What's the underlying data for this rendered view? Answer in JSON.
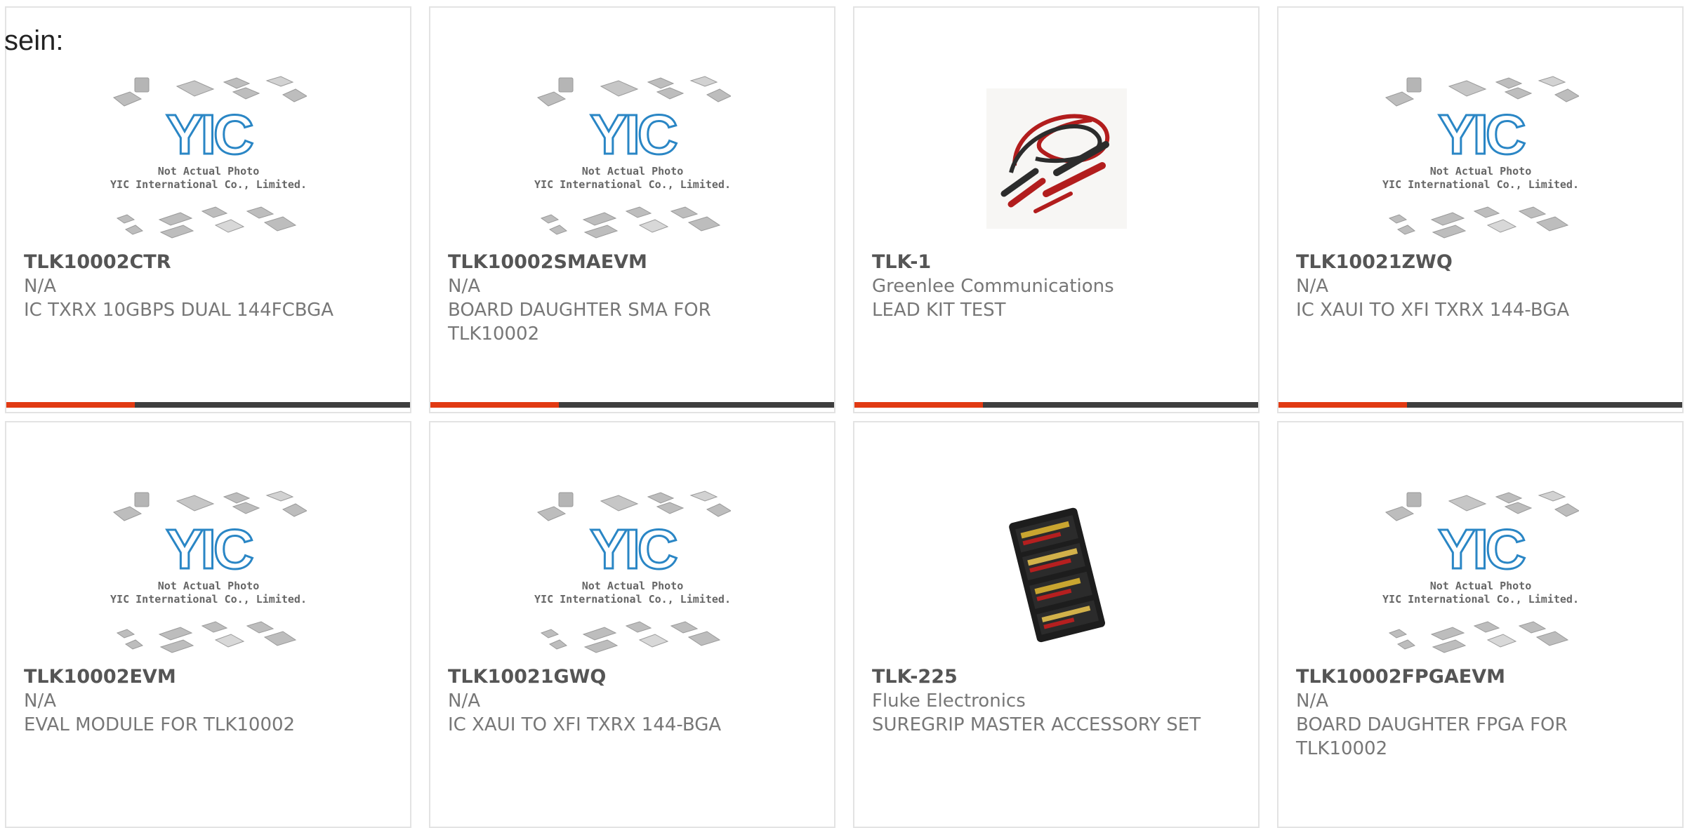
{
  "page": {
    "lead_text": "sein:"
  },
  "placeholder": {
    "logo_text": "YIC",
    "caption_line1": "Not Actual Photo",
    "caption_line2": "YIC International Co., Limited."
  },
  "colors": {
    "accent": "#e13a13",
    "bar": "#3f3f3f",
    "logo_blue": "#2a86c5",
    "text_primary": "#555555",
    "text_secondary": "#777777"
  },
  "products": [
    {
      "part_number": "TLK10002CTR",
      "manufacturer": "N/A",
      "description": "IC TXRX 10GBPS DUAL 144FCBGA",
      "image": "placeholder"
    },
    {
      "part_number": "TLK10002SMAEVM",
      "manufacturer": "N/A",
      "description": "BOARD DAUGHTER SMA FOR TLK10002",
      "image": "placeholder"
    },
    {
      "part_number": "TLK-1",
      "manufacturer": "Greenlee Communications",
      "description": "LEAD KIT TEST",
      "image": "test-leads-photo"
    },
    {
      "part_number": "TLK10021ZWQ",
      "manufacturer": "N/A",
      "description": "IC XAUI TO XFI TXRX 144-BGA",
      "image": "placeholder"
    },
    {
      "part_number": "TLK10002EVM",
      "manufacturer": "N/A",
      "description": "EVAL MODULE FOR TLK10002",
      "image": "placeholder"
    },
    {
      "part_number": "TLK10021GWQ",
      "manufacturer": "N/A",
      "description": "IC XAUI TO XFI TXRX 144-BGA",
      "image": "placeholder"
    },
    {
      "part_number": "TLK-225",
      "manufacturer": "Fluke Electronics",
      "description": "SUREGRIP MASTER ACCESSORY SET",
      "image": "accessory-kit-photo"
    },
    {
      "part_number": "TLK10002FPGAEVM",
      "manufacturer": "N/A",
      "description": "BOARD DAUGHTER FPGA FOR TLK10002",
      "image": "placeholder"
    }
  ]
}
